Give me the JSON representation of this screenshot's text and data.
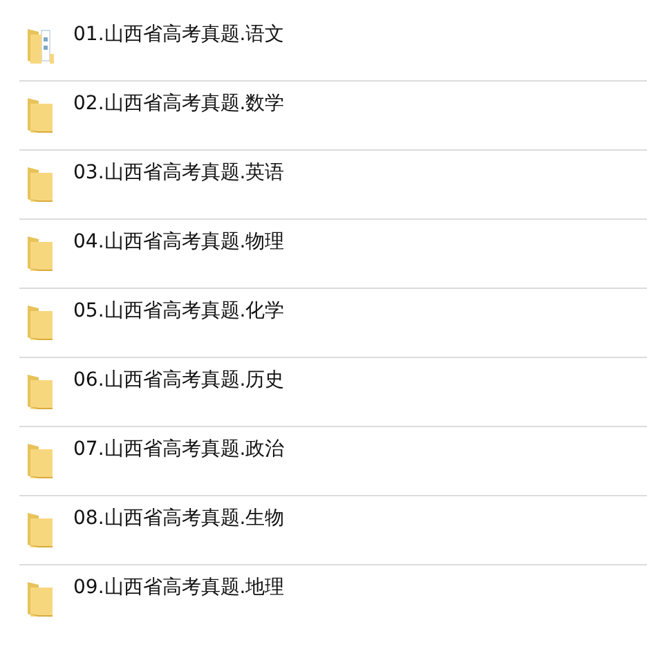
{
  "files": [
    {
      "name": "01.山西省高考真题.语文",
      "kind": "folder-with-file"
    },
    {
      "name": "02.山西省高考真题.数学",
      "kind": "folder"
    },
    {
      "name": "03.山西省高考真题.英语",
      "kind": "folder"
    },
    {
      "name": "04.山西省高考真题.物理",
      "kind": "folder"
    },
    {
      "name": "05.山西省高考真题.化学",
      "kind": "folder"
    },
    {
      "name": "06.山西省高考真题.历史",
      "kind": "folder"
    },
    {
      "name": "07.山西省高考真题.政治",
      "kind": "folder"
    },
    {
      "name": "08.山西省高考真题.生物",
      "kind": "folder"
    },
    {
      "name": "09.山西省高考真题.地理",
      "kind": "folder"
    }
  ]
}
